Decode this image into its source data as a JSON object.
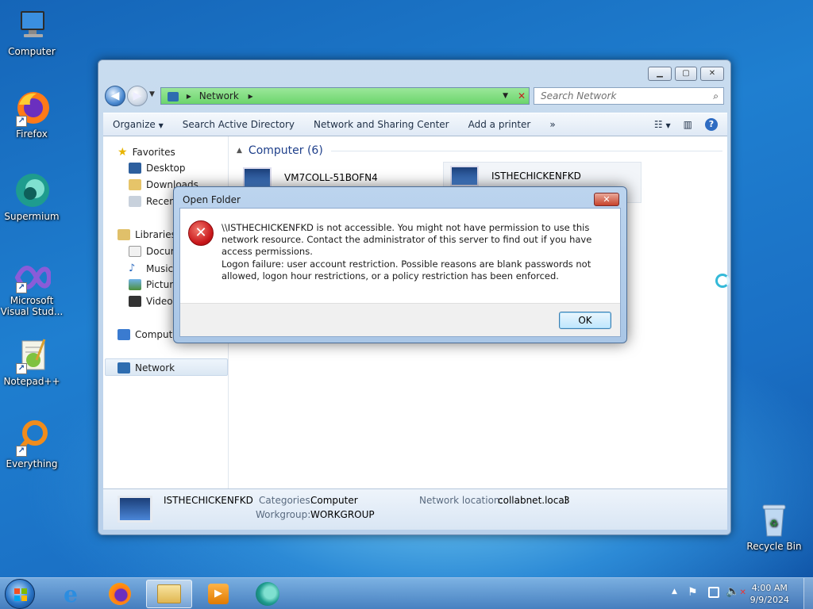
{
  "desktop": {
    "icons": [
      {
        "label": "Computer",
        "icon": "computer-icon"
      },
      {
        "label": "Firefox",
        "icon": "firefox-icon"
      },
      {
        "label": "Supermium",
        "icon": "supermium-icon"
      },
      {
        "label": "Microsoft Visual Stud...",
        "icon": "visual-studio-icon"
      },
      {
        "label": "Notepad++",
        "icon": "notepadpp-icon"
      },
      {
        "label": "Everything",
        "icon": "everything-icon"
      },
      {
        "label": "Recycle Bin",
        "icon": "recycle-bin-icon"
      }
    ]
  },
  "explorer": {
    "address": {
      "path": "Network",
      "separator": "▸"
    },
    "search": {
      "placeholder": "Search Network"
    },
    "toolbar": {
      "organize": "Organize",
      "search_ad": "Search Active Directory",
      "network_sharing": "Network and Sharing Center",
      "add_printer": "Add a printer",
      "more": "»"
    },
    "nav": {
      "favorites": "Favorites",
      "desktop": "Desktop",
      "downloads": "Downloads",
      "recent": "Recent",
      "libraries": "Libraries",
      "documents": "Docum",
      "music": "Music",
      "pictures": "Picture",
      "videos": "Videos",
      "computer": "Compute",
      "network": "Network"
    },
    "group": {
      "header": "Computer (6)"
    },
    "computers": [
      "VM7COLL-51BOFN4",
      "ISTHECHICKENFKD"
    ],
    "details": {
      "name": "ISTHECHICKENFKD",
      "categories_label": "Categories:",
      "categories_value": "Computer",
      "workgroup_label": "Workgroup:",
      "workgroup_value": "WORKGROUP",
      "network_location_label": "Network location:",
      "network_location_value": "collabnet.local",
      "extra": "3"
    }
  },
  "dialog": {
    "title": "Open Folder",
    "message1": "\\\\ISTHECHICKENFKD is not accessible. You might not have permission to use this network resource. Contact the administrator of this server to find out if you have access permissions.",
    "message2": "Logon failure: user account restriction. Possible reasons are blank passwords not allowed, logon hour restrictions, or a policy restriction has been enforced.",
    "ok": "OK"
  },
  "taskbar": {
    "time": "4:00 AM",
    "date": "9/9/2024"
  }
}
